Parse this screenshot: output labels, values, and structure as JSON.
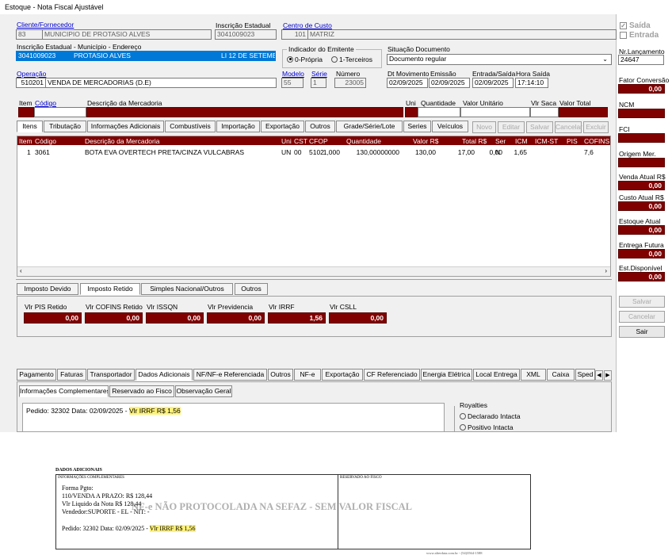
{
  "window": {
    "title": "Estoque - Nota Fiscal Ajustável"
  },
  "header": {
    "cliente_label": "Cliente/Fornecedor",
    "cliente_code": "83",
    "cliente_name": "MUNICIPIO DE PROTASIO ALVES",
    "inscricao_label": "Inscrição Estadual",
    "inscricao_value": "3041009023",
    "centro_label": "Centro de Custo",
    "centro_code": "101",
    "centro_name": "MATRIZ",
    "ie_label": "Inscrição Estadual - Município - Endereço",
    "ie_value": "3041009023",
    "municipio_value": "PROTASIO ALVES",
    "endereco_value": "LI 12 DE SETEMBR",
    "indicador_label": "Indicador do Emitente",
    "opt_propria": "0-Própria",
    "opt_terceiros": "1-Terceiros",
    "situacao_label": "Situação Documento",
    "situacao_value": "Documento regular",
    "operacao_label": "Operação",
    "operacao_code": "510201",
    "operacao_desc": "VENDA DE MERCADORIAS (D.E)",
    "modelo_label": "Modelo",
    "modelo_value": "55",
    "serie_label": "Série",
    "serie_value": "1",
    "numero_label": "Número",
    "numero_value": "23005",
    "dtmov_label": "Dt Movimento",
    "dtmov_value": "02/09/2025",
    "emissao_label": "Emissão",
    "emissao_value": "02/09/2025",
    "entrada_label": "Entrada/Saída",
    "entrada_value": "02/09/2025",
    "hora_label": "Hora Saída",
    "hora_value": "17:14:10"
  },
  "right_panel": {
    "saida": "Saída",
    "entrada": "Entrada",
    "nr_label": "Nr.Lançamento",
    "nr_value": "24647",
    "fator_label": "Fator Conversão",
    "fator_value": "0,00",
    "ncm_label": "NCM",
    "fci_label": "FCI",
    "origem_label": "Origem Mer.",
    "venda_label": "Venda Atual R$",
    "venda_value": "0,00",
    "custo_label": "Custo Atual R$",
    "custo_value": "0,00",
    "estoque_label": "Estoque Atual",
    "estoque_value": "0,00",
    "entrega_label": "Entrega Futura",
    "entrega_value": "0,00",
    "estdisp_label": "Est.Disponível",
    "estdisp_value": "0,00",
    "salvar": "Salvar",
    "cancelar": "Cancelar",
    "sair": "Sair"
  },
  "item_entry": {
    "item": "Item",
    "codigo": "Código",
    "descricao": "Descrição da Mercadoria",
    "uni": "Uni",
    "quantidade": "Quantidade",
    "valor_unitario": "Valor Unitário",
    "vlr_saca": "Vlr Saca",
    "valor_total": "Valor Total"
  },
  "item_tabs": [
    {
      "label": "Itens"
    },
    {
      "label": "Tributação"
    },
    {
      "label": "Informações Adicionais"
    },
    {
      "label": "Combustíveis"
    },
    {
      "label": "Importação"
    },
    {
      "label": "Exportação"
    },
    {
      "label": "Outros"
    },
    {
      "label": "Grade/Série/Lote"
    },
    {
      "label": "Series"
    },
    {
      "label": "Veículos"
    }
  ],
  "item_actions": {
    "novo": "Novo",
    "editar": "Editar",
    "salvar": "Salvar",
    "cancelar": "Cancelar",
    "excluir": "Excluir"
  },
  "grid": {
    "headers": [
      "Item",
      "Código",
      "Descrição da Mercadoria",
      "Uni",
      "CST",
      "CFOP",
      "Quantidade",
      "Valor R$",
      "Total R$",
      "Ser",
      "ICM",
      "ICM-ST",
      "PIS",
      "COFINS"
    ],
    "row": [
      "1",
      "3061",
      "BOTA EVA OVERTECH PRETA/CINZA VULCABRAS",
      "UN",
      "00",
      "5102",
      "1,000",
      "130,00000000",
      "130,00",
      "N",
      "17,00",
      "0,00",
      "1,65",
      "7,6"
    ]
  },
  "impostos": {
    "tabs": [
      "Imposto Devido",
      "Imposto Retido",
      "Simples Nacional/Outros",
      "Outros"
    ],
    "fields": [
      {
        "label": "Vlr PIS Retido",
        "value": "0,00"
      },
      {
        "label": "Vlr COFINS Retido",
        "value": "0,00"
      },
      {
        "label": "Vlr ISSQN",
        "value": "0,00"
      },
      {
        "label": "Vlr Previdencia",
        "value": "0,00"
      },
      {
        "label": "Vlr IRRF",
        "value": "1,56"
      },
      {
        "label": "Vlr CSLL",
        "value": "0,00"
      }
    ]
  },
  "bottom_tabs": [
    "Pagamento",
    "Faturas",
    "Transportador",
    "Dados Adicionais",
    "NF/NF-e Referenciada",
    "Outros",
    "NF-e",
    "Exportação",
    "CF Referenciado",
    "Energia Elétrica",
    "Local Entrega",
    "XML",
    "Caixa",
    "Sped"
  ],
  "info_tabs": [
    "Informações Complementares",
    "Reservado ao Fisco",
    "Observação Geral"
  ],
  "info": {
    "pedido_text": "Pedido: 32302    Data: 02/09/2025 - ",
    "irrf_text": "Vlr IRRF R$ 1,56",
    "royalties_label": "Royalties",
    "declarado": "Declarado Intacta",
    "positivo": "Positivo Intacta"
  },
  "danfe": {
    "title": "DADOS ADICIONAIS",
    "info_label": "INFORMAÇÕES COMPLEMENTARES",
    "fisco_label": "RESERVADO AO FISCO",
    "line1": "Forma Pgto:",
    "line2": "110/VENDA A PRAZO: R$ 128,44",
    "line3": "Vlr Liquido da Nota R$ 128,44",
    "line4": "Vendedor:SUPORTE - EL -  NIT: -",
    "pedido": "Pedido: 32302    Data: 02/09/2025 - ",
    "irrf": "Vlr IRRF R$ 1,56",
    "watermark": "NF-e NÃO PROTOCOLADA NA SEFAZ - SEM VALOR FISCAL",
    "footer": "www.alterdata.com.br - (54)3564-1588"
  }
}
